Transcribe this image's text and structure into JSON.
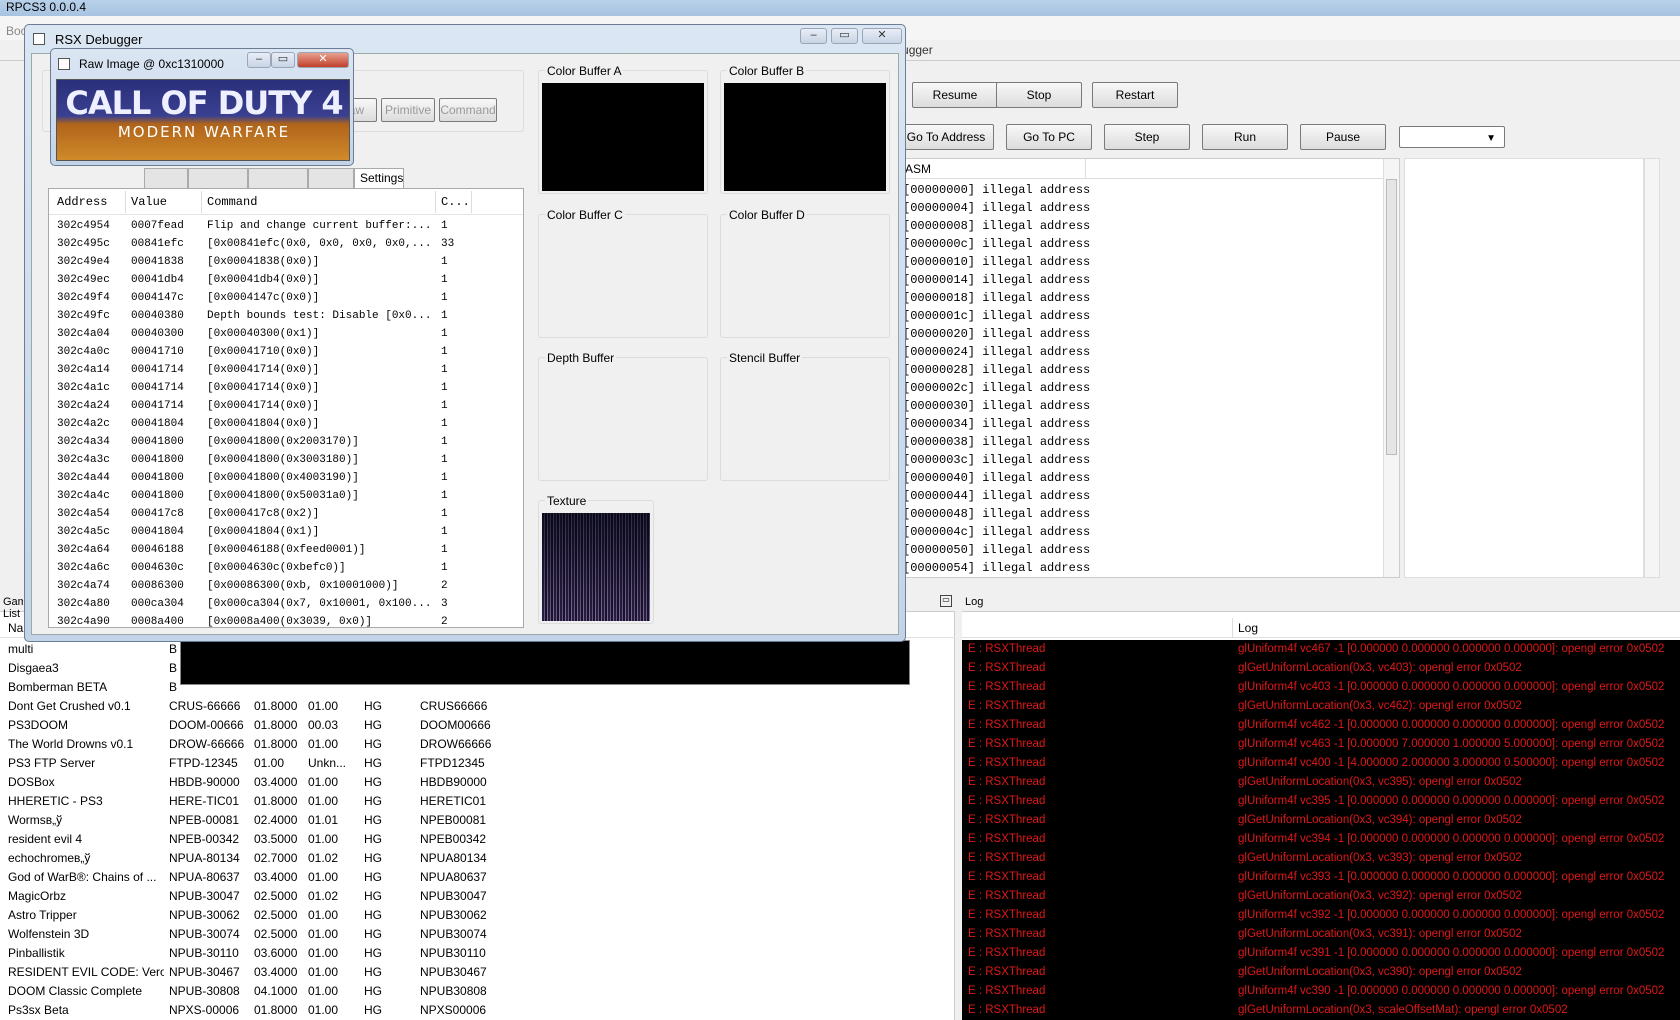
{
  "main_window": {
    "title": "RPCS3 0.0.0.4",
    "menu": [
      "Boot"
    ],
    "game_list_title": "Game List",
    "log_title": "Log",
    "debugger_title": "Debugger"
  },
  "debugger_toolbar": {
    "row1": [
      "Resume",
      "Stop",
      "Restart"
    ],
    "row2": [
      "Go To Address",
      "Go To PC",
      "Step",
      "Run",
      "Pause"
    ]
  },
  "disasm": {
    "header": "ASM",
    "lines": [
      "[00000000] illegal address",
      "[00000004] illegal address",
      "[00000008] illegal address",
      "[0000000c] illegal address",
      "[00000010] illegal address",
      "[00000014] illegal address",
      "[00000018] illegal address",
      "[0000001c] illegal address",
      "[00000020] illegal address",
      "[00000024] illegal address",
      "[00000028] illegal address",
      "[0000002c] illegal address",
      "[00000030] illegal address",
      "[00000034] illegal address",
      "[00000038] illegal address",
      "[0000003c] illegal address",
      "[00000040] illegal address",
      "[00000044] illegal address",
      "[00000048] illegal address",
      "[0000004c] illegal address",
      "[00000050] illegal address",
      "[00000054] illegal address"
    ]
  },
  "game_list": {
    "name_header": "Name",
    "rows": [
      [
        "multi",
        "B",
        "",
        "",
        "",
        ""
      ],
      [
        "Disgaea3",
        "B",
        "",
        "",
        "",
        ""
      ],
      [
        "Bomberman BETA",
        "B",
        "",
        "",
        "",
        ""
      ],
      [
        "Dont Get Crushed v0.1",
        "CRUS-66666",
        "01.8000",
        "01.00",
        "HG",
        "CRUS66666"
      ],
      [
        "PS3DOOM",
        "DOOM-00666",
        "01.8000",
        "00.03",
        "HG",
        "DOOM00666"
      ],
      [
        "The World Drowns v0.1",
        "DROW-66666",
        "01.8000",
        "01.00",
        "HG",
        "DROW66666"
      ],
      [
        "PS3 FTP Server",
        "FTPD-12345",
        "01.00",
        "Unkn...",
        "HG",
        "FTPD12345"
      ],
      [
        "DOSBox",
        "HBDB-90000",
        "03.4000",
        "01.00",
        "HG",
        "HBDB90000"
      ],
      [
        "HHERETIC - PS3",
        "HERE-TIC01",
        "01.8000",
        "01.00",
        "HG",
        "HERETIC01"
      ],
      [
        "Wormsв„ў",
        "NPEB-00081",
        "02.4000",
        "01.01",
        "HG",
        "NPEB00081"
      ],
      [
        "resident evil 4",
        "NPEB-00342",
        "03.5000",
        "01.00",
        "HG",
        "NPEB00342"
      ],
      [
        "echochromeв„ў",
        "NPUA-80134",
        "02.7000",
        "01.02",
        "HG",
        "NPUA80134"
      ],
      [
        "God of WarB®: Chains of ...",
        "NPUA-80637",
        "03.4000",
        "01.00",
        "HG",
        "NPUA80637"
      ],
      [
        "MagicOrbz",
        "NPUB-30047",
        "02.5000",
        "01.02",
        "HG",
        "NPUB30047"
      ],
      [
        "Astro Tripper",
        "NPUB-30062",
        "02.5000",
        "01.00",
        "HG",
        "NPUB30062"
      ],
      [
        "Wolfenstein 3D",
        "NPUB-30074",
        "02.5000",
        "01.00",
        "HG",
        "NPUB30074"
      ],
      [
        "Pinballistik",
        "NPUB-30110",
        "03.6000",
        "01.00",
        "HG",
        "NPUB30110"
      ],
      [
        "RESIDENT EVIL CODE: Vero...",
        "NPUB-30467",
        "03.4000",
        "01.00",
        "HG",
        "NPUB30467"
      ],
      [
        "DOOM Classic Complete",
        "NPUB-30808",
        "04.1000",
        "01.00",
        "HG",
        "NPUB30808"
      ],
      [
        "Ps3sx Beta",
        "NPXS-00006",
        "01.8000",
        "01.00",
        "HG",
        "NPXS00006"
      ]
    ]
  },
  "log": {
    "header": "Log",
    "rows": [
      [
        "E : RSXThread",
        "glUniform4f vc467 -1 [0.000000 0.000000 0.000000 0.000000]: opengl error 0x0502"
      ],
      [
        "E : RSXThread",
        "glGetUniformLocation(0x3, vc403): opengl error 0x0502"
      ],
      [
        "E : RSXThread",
        "glUniform4f vc403 -1 [0.000000 0.000000 0.000000 0.000000]: opengl error 0x0502"
      ],
      [
        "E : RSXThread",
        "glGetUniformLocation(0x3, vc462): opengl error 0x0502"
      ],
      [
        "E : RSXThread",
        "glUniform4f vc462 -1 [0.000000 0.000000 0.000000 0.000000]: opengl error 0x0502"
      ],
      [
        "E : RSXThread",
        "glUniform4f vc463 -1 [0.000000 7.000000 1.000000 5.000000]: opengl error 0x0502"
      ],
      [
        "E : RSXThread",
        "glUniform4f vc400 -1 [4.000000 2.000000 3.000000 0.500000]: opengl error 0x0502"
      ],
      [
        "E : RSXThread",
        "glGetUniformLocation(0x3, vc395): opengl error 0x0502"
      ],
      [
        "E : RSXThread",
        "glUniform4f vc395 -1 [0.000000 0.000000 0.000000 0.000000]: opengl error 0x0502"
      ],
      [
        "E : RSXThread",
        "glGetUniformLocation(0x3, vc394): opengl error 0x0502"
      ],
      [
        "E : RSXThread",
        "glUniform4f vc394 -1 [0.000000 0.000000 0.000000 0.000000]: opengl error 0x0502"
      ],
      [
        "E : RSXThread",
        "glGetUniformLocation(0x3, vc393): opengl error 0x0502"
      ],
      [
        "E : RSXThread",
        "glUniform4f vc393 -1 [0.000000 0.000000 0.000000 0.000000]: opengl error 0x0502"
      ],
      [
        "E : RSXThread",
        "glGetUniformLocation(0x3, vc392): opengl error 0x0502"
      ],
      [
        "E : RSXThread",
        "glUniform4f vc392 -1 [0.000000 0.000000 0.000000 0.000000]: opengl error 0x0502"
      ],
      [
        "E : RSXThread",
        "glGetUniformLocation(0x3, vc391): opengl error 0x0502"
      ],
      [
        "E : RSXThread",
        "glUniform4f vc391 -1 [0.000000 0.000000 0.000000 0.000000]: opengl error 0x0502"
      ],
      [
        "E : RSXThread",
        "glGetUniformLocation(0x3, vc390): opengl error 0x0502"
      ],
      [
        "E : RSXThread",
        "glUniform4f vc390 -1 [0.000000 0.000000 0.000000 0.000000]: opengl error 0x0502"
      ],
      [
        "E : RSXThread",
        "glGetUniformLocation(0x3, scaleOffsetMat): opengl error 0x0502"
      ]
    ]
  },
  "rsx": {
    "title": "RSX Debugger",
    "buttons": [
      "Draw",
      "Primitive",
      "Command"
    ],
    "tabs": [
      "Settings"
    ],
    "columns": [
      "Address",
      "Value",
      "Command",
      "C..."
    ],
    "rows": [
      [
        "302c4954",
        "0007fead",
        "Flip and change current buffer:...",
        "1"
      ],
      [
        "302c495c",
        "00841efc",
        "[0x00841efc(0x0, 0x0, 0x0, 0x0,...",
        "33"
      ],
      [
        "302c49e4",
        "00041838",
        "[0x00041838(0x0)]",
        "1"
      ],
      [
        "302c49ec",
        "00041db4",
        "[0x00041db4(0x0)]",
        "1"
      ],
      [
        "302c49f4",
        "0004147c",
        "[0x0004147c(0x0)]",
        "1"
      ],
      [
        "302c49fc",
        "00040380",
        "Depth bounds test: Disable [0x0...",
        "1"
      ],
      [
        "302c4a04",
        "00040300",
        "[0x00040300(0x1)]",
        "1"
      ],
      [
        "302c4a0c",
        "00041710",
        "[0x00041710(0x0)]",
        "1"
      ],
      [
        "302c4a14",
        "00041714",
        "[0x00041714(0x0)]",
        "1"
      ],
      [
        "302c4a1c",
        "00041714",
        "[0x00041714(0x0)]",
        "1"
      ],
      [
        "302c4a24",
        "00041714",
        "[0x00041714(0x0)]",
        "1"
      ],
      [
        "302c4a2c",
        "00041804",
        "[0x00041804(0x0)]",
        "1"
      ],
      [
        "302c4a34",
        "00041800",
        "[0x00041800(0x2003170)]",
        "1"
      ],
      [
        "302c4a3c",
        "00041800",
        "[0x00041800(0x3003180)]",
        "1"
      ],
      [
        "302c4a44",
        "00041800",
        "[0x00041800(0x4003190)]",
        "1"
      ],
      [
        "302c4a4c",
        "00041800",
        "[0x00041800(0x50031a0)]",
        "1"
      ],
      [
        "302c4a54",
        "000417c8",
        "[0x000417c8(0x2)]",
        "1"
      ],
      [
        "302c4a5c",
        "00041804",
        "[0x00041804(0x1)]",
        "1"
      ],
      [
        "302c4a64",
        "00046188",
        "[0x00046188(0xfeed0001)]",
        "1"
      ],
      [
        "302c4a6c",
        "0004630c",
        "[0x0004630c(0xbefc0)]",
        "1"
      ],
      [
        "302c4a74",
        "00086300",
        "[0x00086300(0xb, 0x10001000)]",
        "2"
      ],
      [
        "302c4a80",
        "000ca304",
        "[0x000ca304(0x7, 0x10001, 0x100...",
        "3"
      ],
      [
        "302c4a90",
        "0008a400",
        "[0x0008a400(0x3039, 0x0)]",
        "2"
      ]
    ],
    "buffers": {
      "a": "Color Buffer A",
      "b": "Color Buffer B",
      "c": "Color Buffer C",
      "d": "Color Buffer D",
      "depth": "Depth Buffer",
      "stencil": "Stencil Buffer",
      "texture": "Texture"
    }
  },
  "raw_image": {
    "title": "Raw Image @ 0xc1310000",
    "logo_line1": "CALL OF DUTY 4",
    "logo_line2": "MODERN WARFARE"
  }
}
